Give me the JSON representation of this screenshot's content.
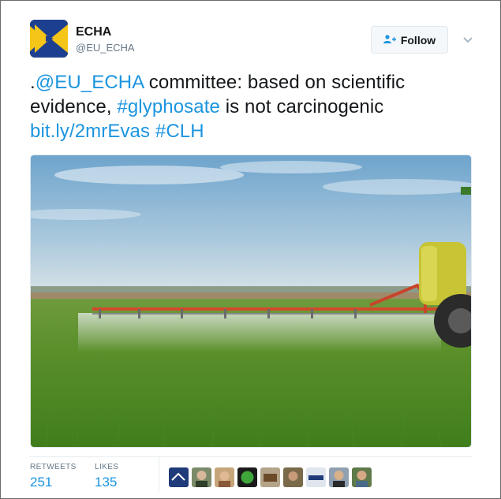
{
  "account": {
    "name": "ECHA",
    "handle": "@EU_ECHA",
    "brand_colors": {
      "blue": "#1d3f8f",
      "yellow": "#f5c518"
    }
  },
  "follow_button": {
    "label": "Follow",
    "icon": "add-user-icon"
  },
  "tweet": {
    "prefix": ".",
    "mention": "@EU_ECHA",
    "text1": " committee: based on scientific evidence, ",
    "hashtag1": "#glyphosate",
    "text2": " is not carcinogenic",
    "link": "bit.ly/2mrEvas",
    "space": " ",
    "hashtag2": "#CLH"
  },
  "media": {
    "description_icon": "tractor-spraying-field-photo"
  },
  "stats": {
    "retweets_label": "RETWEETS",
    "retweets_value": "251",
    "likes_label": "LIKES",
    "likes_value": "135"
  },
  "colors": {
    "link": "#1b95e0",
    "muted": "#657786"
  }
}
